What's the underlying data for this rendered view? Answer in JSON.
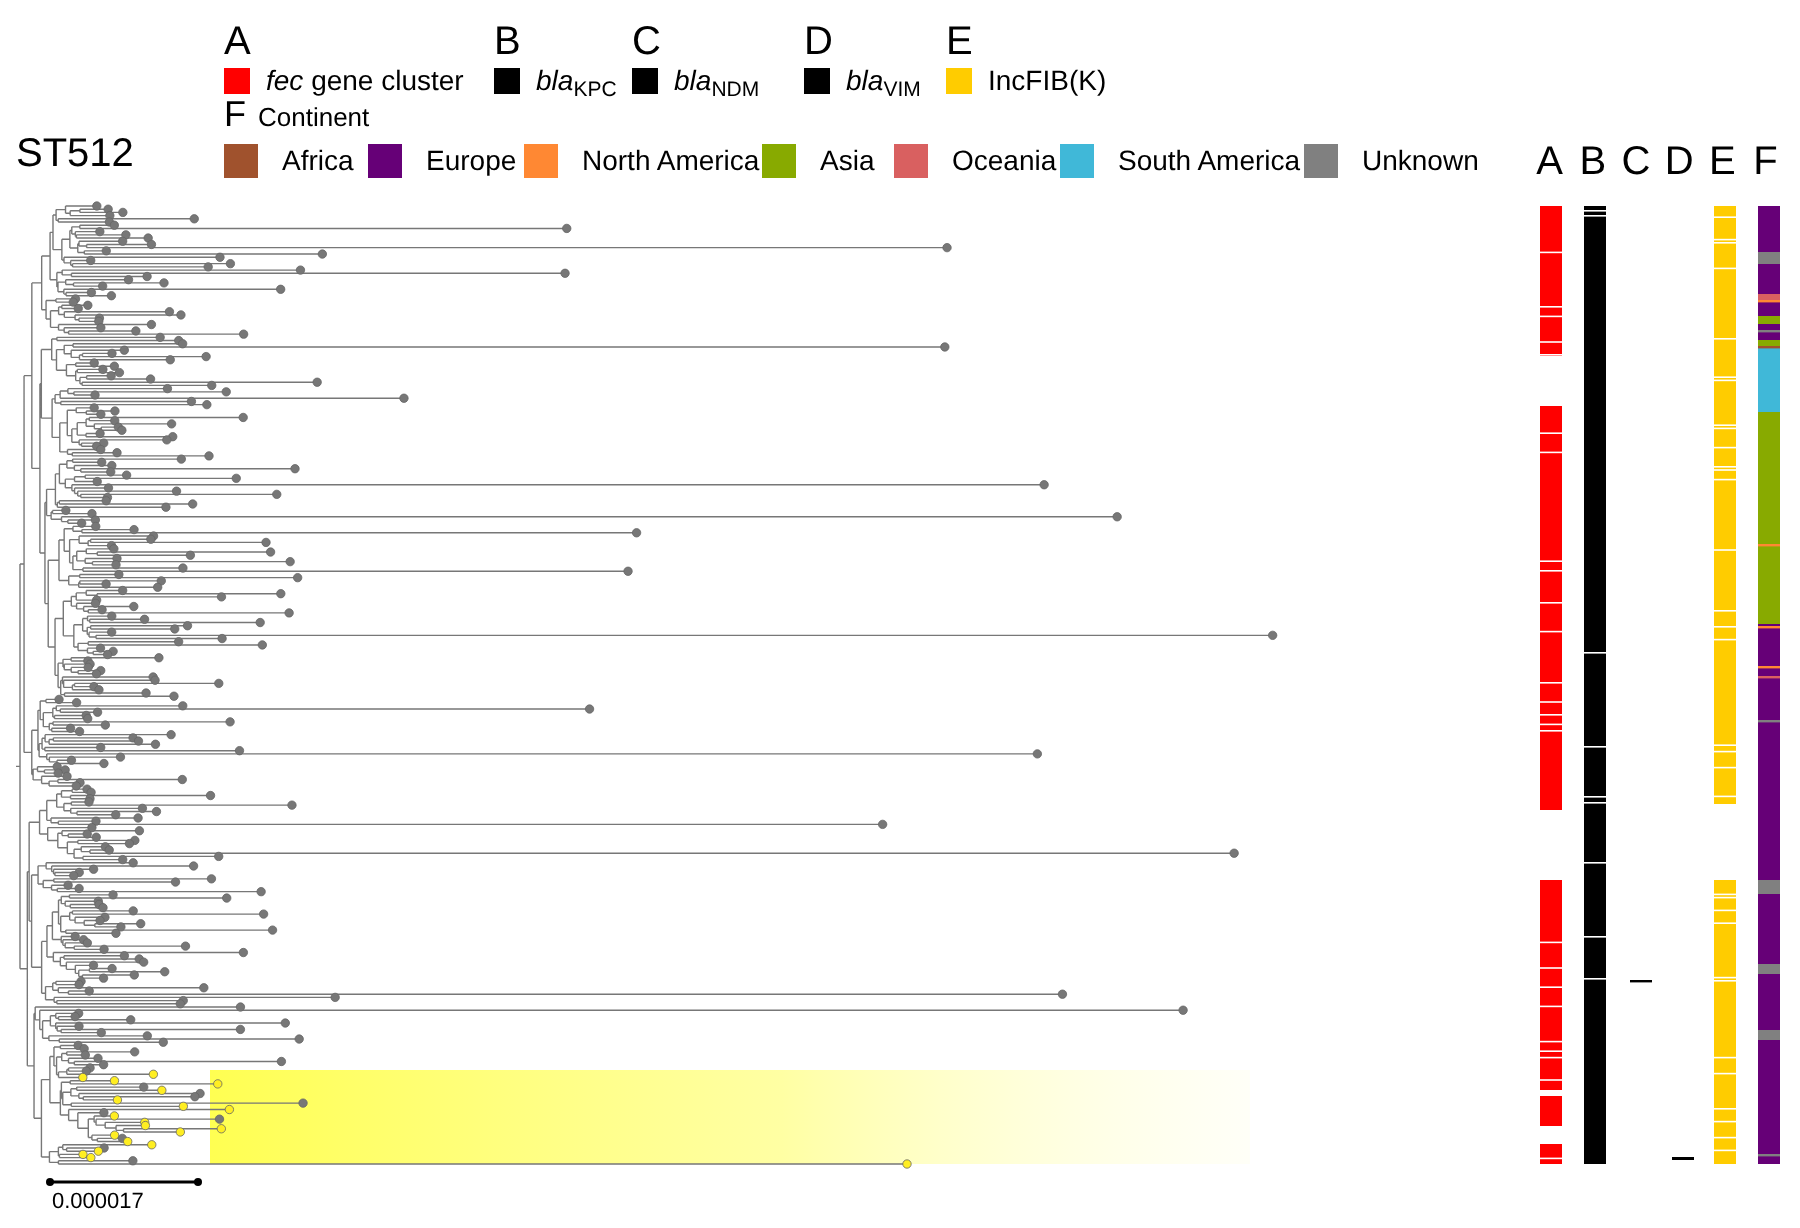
{
  "title": "ST512",
  "gene_legend": [
    {
      "letter": "A",
      "label": "*fec* gene cluster",
      "color": "#ff0000"
    },
    {
      "letter": "B",
      "label": "*bla*$_{KPC}$",
      "color": "#000000"
    },
    {
      "letter": "C",
      "label": "*bla*$_{NDM}$",
      "color": "#000000"
    },
    {
      "letter": "D",
      "label": "*bla*$_{VIM}$",
      "color": "#000000"
    },
    {
      "letter": "E",
      "label": "IncFIB(K)",
      "color": "#ffcc00"
    }
  ],
  "continent_legend": {
    "letter": "F",
    "title": "Continent",
    "items": [
      {
        "label": "Africa",
        "color": "#a0522d"
      },
      {
        "label": "Europe",
        "color": "#660077"
      },
      {
        "label": "North America",
        "color": "#ff8833"
      },
      {
        "label": "Asia",
        "color": "#88aa00"
      },
      {
        "label": "Oceania",
        "color": "#d96060"
      },
      {
        "label": "South America",
        "color": "#40b8d8"
      },
      {
        "label": "Unknown",
        "color": "#808080"
      }
    ]
  },
  "track_headers": [
    "A",
    "B",
    "C",
    "D",
    "E",
    "F"
  ],
  "scale_bar": {
    "label": "0.000017"
  }
}
